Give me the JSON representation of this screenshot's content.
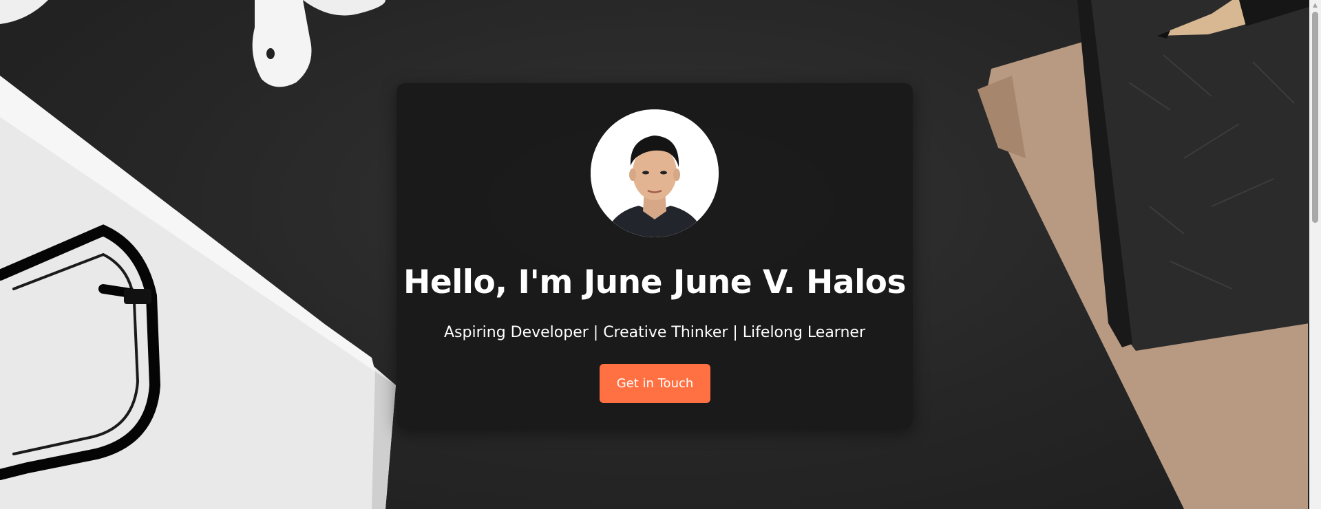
{
  "hero": {
    "title": "Hello, I'm June June V. Halos",
    "subtitle": "Aspiring Developer | Creative Thinker | Lifelong Learner",
    "cta_label": "Get in Touch"
  },
  "colors": {
    "background": "#2a2a2a",
    "card": "#1a1a1a",
    "accent": "#ff7043",
    "text": "#ffffff"
  },
  "icons": {
    "scroll_up": "triangle-up-icon"
  },
  "scroll": {
    "up_glyph": "▲"
  }
}
